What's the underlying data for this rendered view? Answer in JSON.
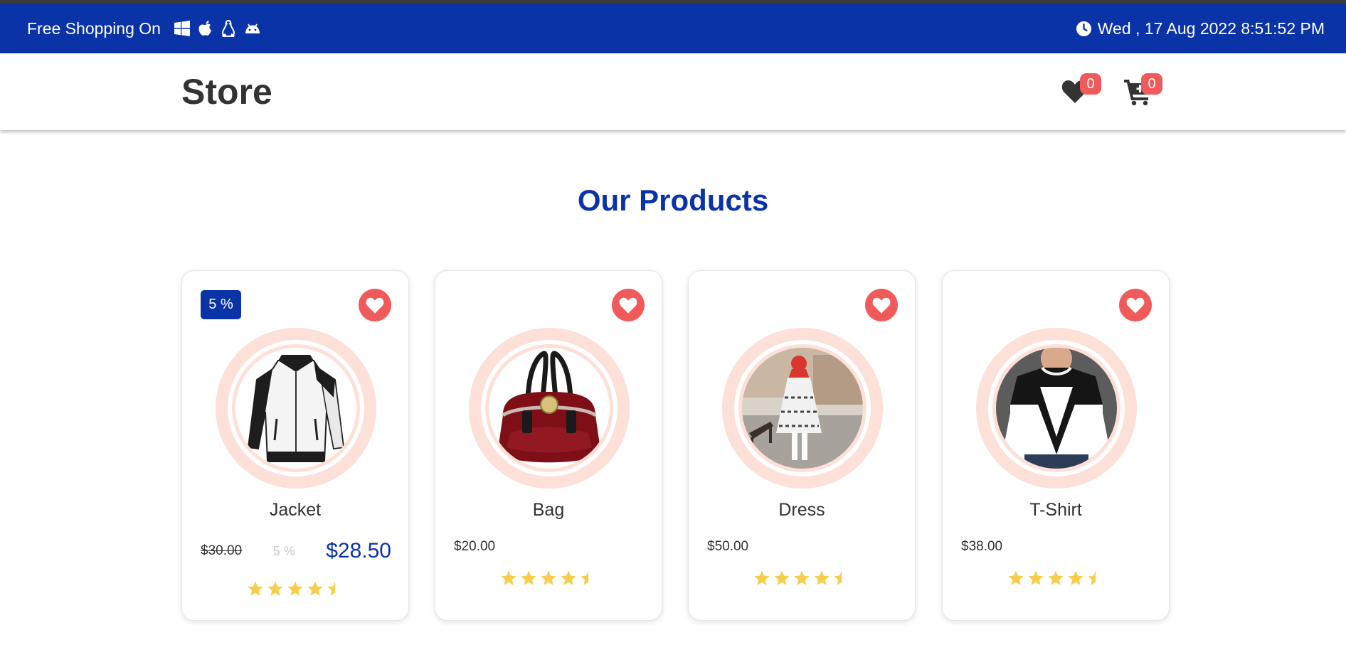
{
  "topbar": {
    "free_shopping": "Free Shopping On",
    "os_icons": [
      "windows-icon",
      "apple-icon",
      "linux-icon",
      "android-icon"
    ],
    "datetime": "Wed , 17 Aug 2022 8:51:52 PM"
  },
  "navbar": {
    "brand": "Store",
    "wishlist_count": "0",
    "cart_count": "0"
  },
  "section_title": "Our Products",
  "products": [
    {
      "name": "Jacket",
      "discount_badge": "5 %",
      "old_price": "$30.00",
      "discount_text": "5 %",
      "new_price": "$28.50",
      "rating": 4.5
    },
    {
      "name": "Bag",
      "price": "$20.00",
      "rating": 4.5
    },
    {
      "name": "Dress",
      "price": "$50.00",
      "rating": 4.5
    },
    {
      "name": "T-Shirt",
      "price": "$38.00",
      "rating": 4.5
    }
  ],
  "colors": {
    "primary_blue": "#0a33a8",
    "accent_red": "#f05a5a",
    "star_gold": "#f7cd4b",
    "ring_peach": "#fde0d7"
  }
}
